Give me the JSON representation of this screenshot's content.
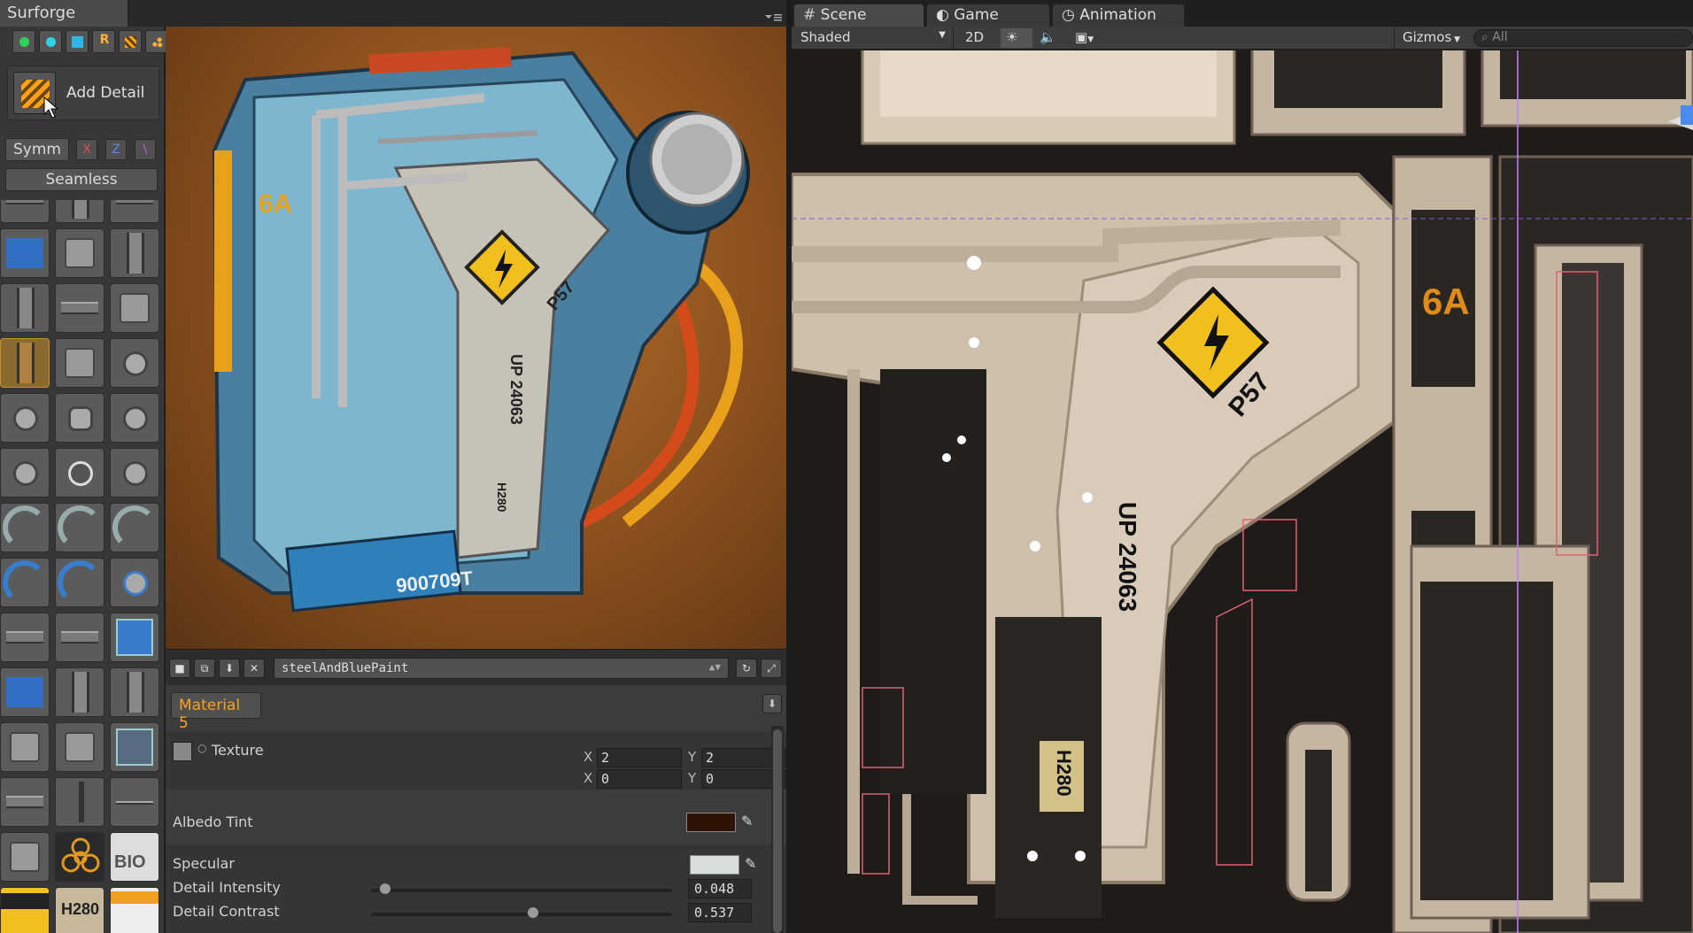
{
  "surforge": {
    "window_title": "Surforge",
    "add_detail_label": "Add Detail",
    "symm_label": "Symm",
    "symm_x": "X",
    "symm_z": "Z",
    "symm_diag": "\\",
    "seamless_label": "Seamless",
    "tool_letter": "R"
  },
  "viewport": {
    "model_label_6a": "6A",
    "model_code_up": "UP 24063",
    "model_code_p": "P57",
    "model_code_num": "900709T",
    "model_code_h": "H280"
  },
  "inspector": {
    "material_name": "steelAndBluePaint",
    "material_tab": "Material 5",
    "texture_label": "Texture",
    "x_label": "X",
    "y_label": "Y",
    "tiling_x": "2",
    "tiling_y": "2",
    "offset_x": "0",
    "offset_y": "0",
    "albedo_label": "Albedo Tint",
    "specular_label": "Specular",
    "detail_intensity_label": "Detail Intensity",
    "detail_intensity_value": "0.048",
    "detail_contrast_label": "Detail Contrast",
    "detail_contrast_value": "0.537",
    "albedo_color": "#2e1207",
    "specular_color": "#d8dedd",
    "detail_intensity_level": 0.048,
    "detail_contrast_level": 0.537
  },
  "scene": {
    "tab_scene": "Scene",
    "tab_game": "Game",
    "tab_animation": "Animation",
    "shading_mode": "Shaded",
    "mode_2d": "2D",
    "gizmos_label": "Gizmos",
    "search_placeholder": "All",
    "texture_text_6a": "6A",
    "texture_text_p57": "P57",
    "texture_text_up": "UP 24063",
    "texture_text_h": "H280"
  },
  "colors": {
    "accent_orange": "#ffa21a",
    "paint_blue": "#2f7fb8",
    "metal_beige": "#c8b9a6",
    "warning_yellow": "#f2c01e"
  }
}
